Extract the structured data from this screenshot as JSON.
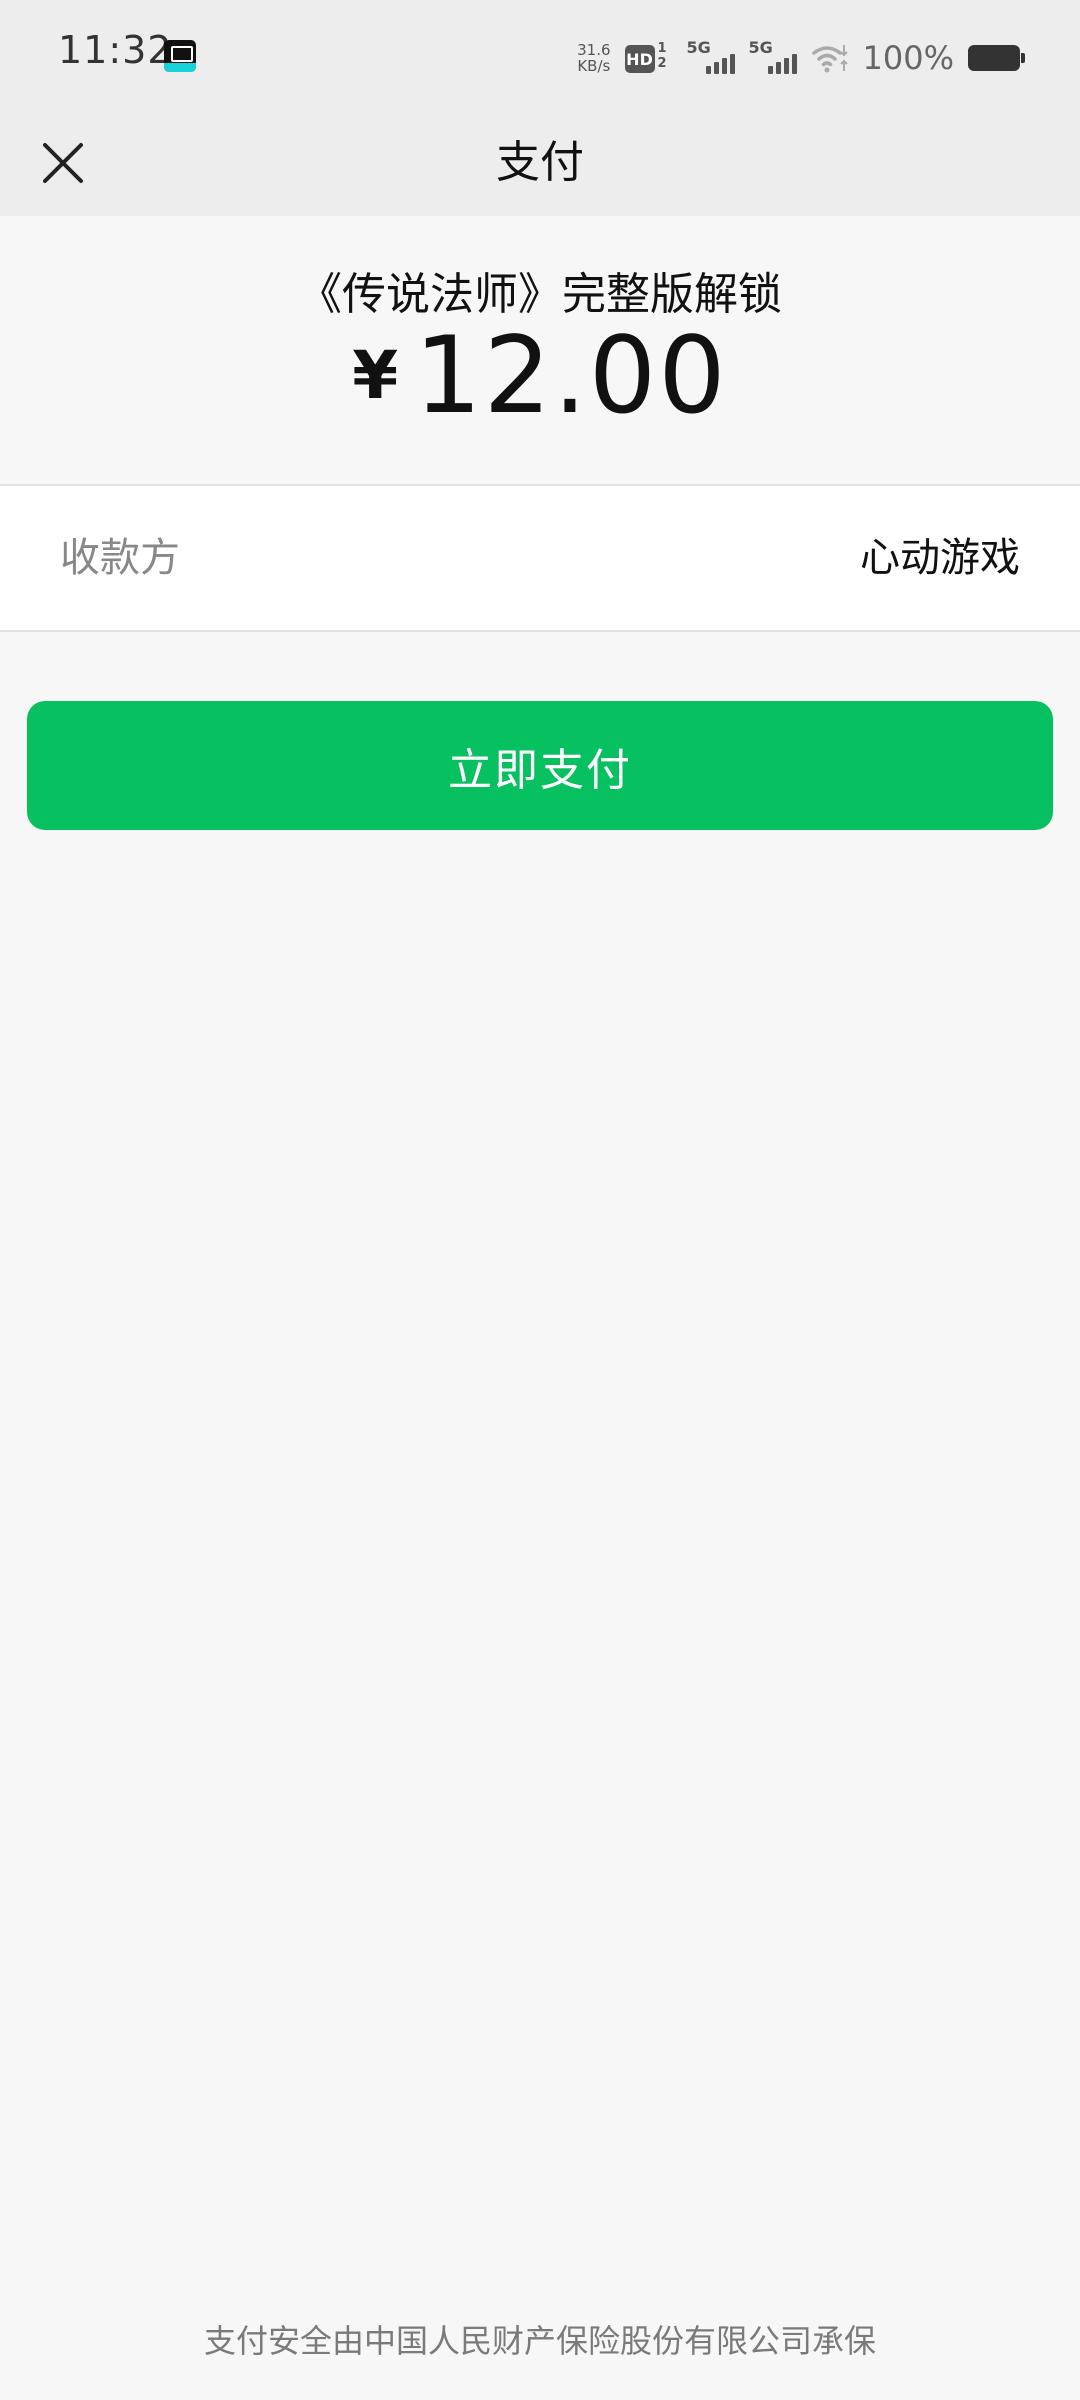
{
  "status_bar": {
    "time": "11:32",
    "net_speed_value": "31.6",
    "net_speed_unit": "KB/s",
    "hd_label": "HD",
    "hd_sim_top": "1",
    "hd_sim_bottom": "2",
    "signal_1_label": "5G",
    "signal_2_label": "5G",
    "battery_text": "100%"
  },
  "nav": {
    "title": "支付",
    "close_icon": "close-icon"
  },
  "order": {
    "product_name": "《传说法师》完整版解锁",
    "currency_symbol": "¥",
    "amount": "12.00"
  },
  "payee": {
    "label": "收款方",
    "value": "心动游戏"
  },
  "actions": {
    "pay_label": "立即支付"
  },
  "footer": {
    "note": "支付安全由中国人民财产保险股份有限公司承保"
  },
  "colors": {
    "primary": "#07c160",
    "nav_background": "#ededed",
    "page_background": "#f7f7f7"
  }
}
